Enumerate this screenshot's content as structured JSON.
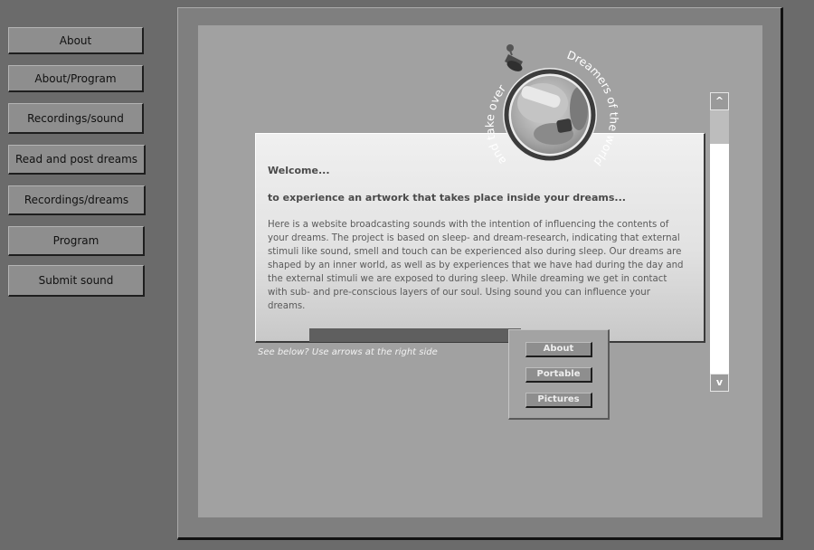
{
  "nav": {
    "items": [
      {
        "label": "About"
      },
      {
        "label": "About/Program"
      },
      {
        "label": "Recordings/sound"
      },
      {
        "label": "Read and post dreams"
      },
      {
        "label": "Recordings/dreams"
      },
      {
        "label": "Program"
      },
      {
        "label": "Submit sound"
      }
    ]
  },
  "logo": {
    "text_left": "and take over",
    "text_right": "Dreamers of the world unite"
  },
  "content": {
    "welcome": "Welcome...",
    "subhead": "to experience an artwork that takes place inside your dreams...",
    "body": "Here is a website broadcasting sounds with the intention of influencing the contents of your dreams. The project is based on sleep- and dream-research, indicating that external stimuli like sound, smell and touch can be experienced also during sleep. Our dreams are shaped by an inner world, as well as by experiences that we have had during the day and the external stimuli we are exposed to during sleep. While dreaming we get in contact with sub- and pre-conscious layers of our soul. Using sound you can influence your dreams."
  },
  "hint": "See below? Use arrows at the right side",
  "submenu": {
    "items": [
      {
        "label": "About"
      },
      {
        "label": "Portable"
      },
      {
        "label": "Pictures"
      }
    ]
  },
  "scroll": {
    "up": "^",
    "down": "v"
  },
  "colors": {
    "background": "#6b6b6b",
    "frame": "#7f7f7f",
    "panel": "#a1a1a1",
    "button": "#8e8e8e"
  }
}
